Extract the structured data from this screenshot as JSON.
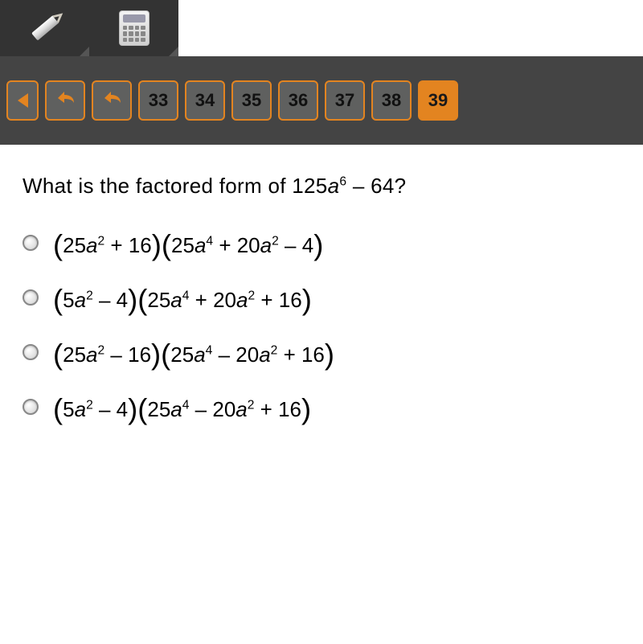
{
  "toolbar": {
    "tools": [
      "pencil-tool",
      "calculator-tool"
    ]
  },
  "nav": {
    "items": [
      {
        "label": "",
        "name": "nav-prev",
        "first": true
      },
      {
        "label": "",
        "name": "nav-undo-1"
      },
      {
        "label": "",
        "name": "nav-undo-2"
      },
      {
        "label": "33",
        "name": "q-33"
      },
      {
        "label": "34",
        "name": "q-34"
      },
      {
        "label": "35",
        "name": "q-35"
      },
      {
        "label": "36",
        "name": "q-36"
      },
      {
        "label": "37",
        "name": "q-37"
      },
      {
        "label": "38",
        "name": "q-38"
      },
      {
        "label": "39",
        "name": "q-39",
        "active": true
      }
    ]
  },
  "question": {
    "lead": "What is the factored form of ",
    "expr_html": "125<span class='it'>a</span><sup>6</sup> – 64",
    "tail": "?"
  },
  "options": [
    {
      "html": "<span class='paren'>(</span><span class='grp'>25<span class='it'>a</span><sup>2</sup> + 16</span><span class='paren'>)</span><span class='paren'>(</span><span class='grp'>25<span class='it'>a</span><sup>4</sup> + 20<span class='it'>a</span><sup>2</sup> – 4</span><span class='paren'>)</span>"
    },
    {
      "html": "<span class='paren'>(</span><span class='grp'>5<span class='it'>a</span><sup>2</sup> – 4</span><span class='paren'>)</span><span class='paren'>(</span><span class='grp'>25<span class='it'>a</span><sup>4</sup> + 20<span class='it'>a</span><sup>2</sup> + 16</span><span class='paren'>)</span>"
    },
    {
      "html": "<span class='paren'>(</span><span class='grp'>25<span class='it'>a</span><sup>2</sup> – 16</span><span class='paren'>)</span><span class='paren'>(</span><span class='grp'>25<span class='it'>a</span><sup>4</sup> – 20<span class='it'>a</span><sup>2</sup> + 16</span><span class='paren'>)</span>"
    },
    {
      "html": "<span class='paren'>(</span><span class='grp'>5<span class='it'>a</span><sup>2</sup> – 4</span><span class='paren'>)</span><span class='paren'>(</span><span class='grp'>25<span class='it'>a</span><sup>4</sup> – 20<span class='it'>a</span><sup>2</sup> + 16</span><span class='paren'>)</span>"
    }
  ]
}
